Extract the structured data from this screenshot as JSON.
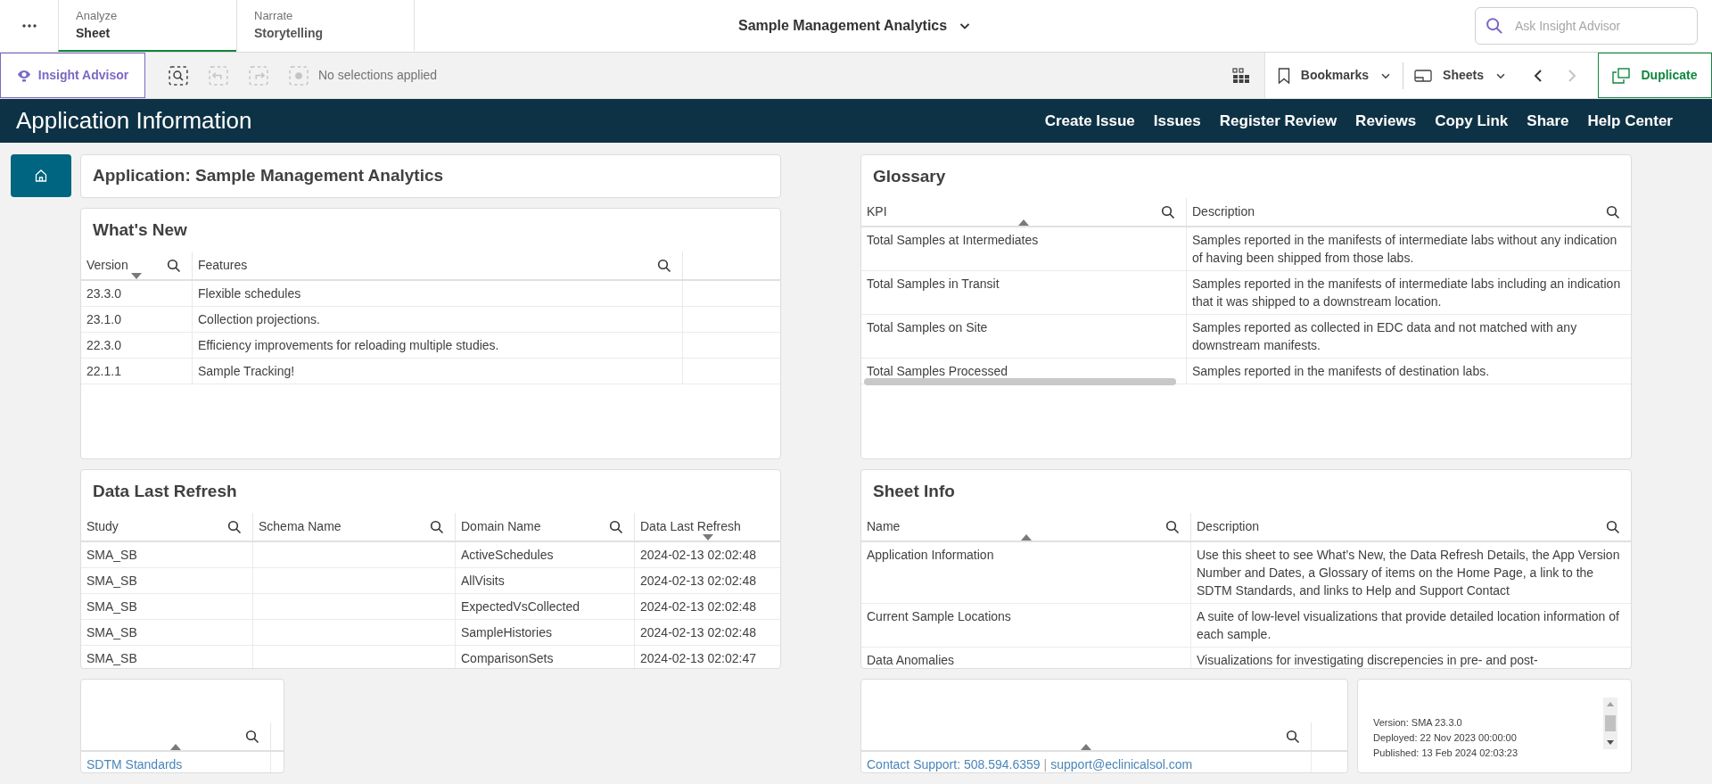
{
  "tabs": [
    {
      "label": "Analyze",
      "sublabel": "Sheet",
      "selected": true
    },
    {
      "label": "Narrate",
      "sublabel": "Storytelling",
      "selected": false
    }
  ],
  "app_title": "Sample Management Analytics",
  "search": {
    "placeholder": "Ask Insight Advisor"
  },
  "toolbar": {
    "insight_advisor": "Insight Advisor",
    "selection_status": "No selections applied",
    "bookmarks": "Bookmarks",
    "sheets": "Sheets",
    "duplicate": "Duplicate",
    "previous_disabled": false,
    "next_disabled": true
  },
  "header": {
    "title": "Application Information",
    "links": [
      "Create Issue",
      "Issues",
      "Register Review",
      "Reviews",
      "Copy Link",
      "Share",
      "Help Center"
    ]
  },
  "application_panel": {
    "title": "Application: Sample Management Analytics"
  },
  "tables": [
    {
      "title": "What's New",
      "columns": [
        {
          "label": "Version",
          "searchable": true,
          "sort_ascending": false,
          "sort_descending": true
        },
        {
          "label": "Features",
          "searchable": true,
          "sort_ascending": false,
          "sort_descending": false
        }
      ],
      "rows": [
        [
          "23.3.0",
          "Flexible schedules"
        ],
        [
          "23.1.0",
          "Collection projections."
        ],
        [
          "22.3.0",
          "Efficiency improvements for reloading multiple studies."
        ],
        [
          "22.1.1",
          "Sample Tracking!"
        ]
      ]
    },
    {
      "title": "Data Last Refresh",
      "columns": [
        {
          "label": "Study",
          "searchable": true,
          "sort_ascending": false,
          "sort_descending": false
        },
        {
          "label": "Schema Name",
          "searchable": true,
          "sort_ascending": false,
          "sort_descending": false
        },
        {
          "label": "Domain Name",
          "searchable": true,
          "sort_ascending": false,
          "sort_descending": false
        },
        {
          "label": "Data Last Refresh",
          "searchable": false,
          "sort_ascending": false,
          "sort_descending": true
        }
      ],
      "rows": [
        [
          "SMA_SB",
          null,
          "ActiveSchedules",
          "2024-02-13 02:02:48"
        ],
        [
          "SMA_SB",
          null,
          "AllVisits",
          "2024-02-13 02:02:48"
        ],
        [
          "SMA_SB",
          null,
          "ExpectedVsCollected",
          "2024-02-13 02:02:48"
        ],
        [
          "SMA_SB",
          null,
          "SampleHistories",
          "2024-02-13 02:02:48"
        ],
        [
          "SMA_SB",
          null,
          "ComparisonSets",
          "2024-02-13 02:02:47"
        ]
      ]
    },
    {
      "columns": [
        {
          "searchable": true,
          "sort_ascending": true,
          "sort_descending": false
        }
      ],
      "rows": [
        [
          {
            "kind": "link",
            "text": "SDTM Standards"
          }
        ]
      ]
    },
    {
      "title": "Glossary",
      "columns": [
        {
          "label": "KPI",
          "searchable": true,
          "sort_ascending": true,
          "sort_descending": false
        },
        {
          "label": "Description",
          "searchable": true,
          "sort_ascending": false,
          "sort_descending": false
        }
      ],
      "rows": [
        [
          "Total Samples at Intermediates",
          "Samples reported in the manifests of intermediate labs without any indication of having been shipped from those labs."
        ],
        [
          "Total Samples in Transit",
          "Samples reported in the manifests of intermediate labs including an indication that it was shipped to a downstream location."
        ],
        [
          "Total Samples on Site",
          "Samples reported as collected in EDC data and not matched with any downstream manifests."
        ],
        [
          "Total Samples Processed",
          "Samples reported in the manifests of destination labs."
        ]
      ]
    },
    {
      "title": "Sheet Info",
      "columns": [
        {
          "label": "Name",
          "searchable": true,
          "sort_ascending": true,
          "sort_descending": false
        },
        {
          "label": "Description",
          "searchable": true,
          "sort_ascending": false,
          "sort_descending": false
        }
      ],
      "rows": [
        [
          "Application Information",
          "Use this sheet to see What’s New, the Data Refresh Details, the App Version Number and Dates, a Glossary of items on the Home Page, a link to the SDTM Standards, and links to Help and Support Contact"
        ],
        [
          "Current Sample Locations",
          "A suite of low-level visualizations that provide detailed location information of each sample."
        ],
        [
          "Data Anomalies",
          "Visualizations for investigating discrepencies in pre- and post-"
        ]
      ]
    },
    {
      "columns": [
        {
          "searchable": true,
          "sort_ascending": true,
          "sort_descending": false
        }
      ],
      "rows": [
        [
          {
            "kind": "links",
            "links": [
              "Contact Support: 508.594.6359",
              "support@eclinicalsol.com"
            ],
            "separator": "|"
          }
        ]
      ]
    }
  ],
  "version_info": {
    "lines": [
      "Version: SMA 23.3.0",
      "Deployed: 22 Nov 2023 00:00:00",
      "Published: 13 Feb 2024 02:03:23"
    ]
  }
}
